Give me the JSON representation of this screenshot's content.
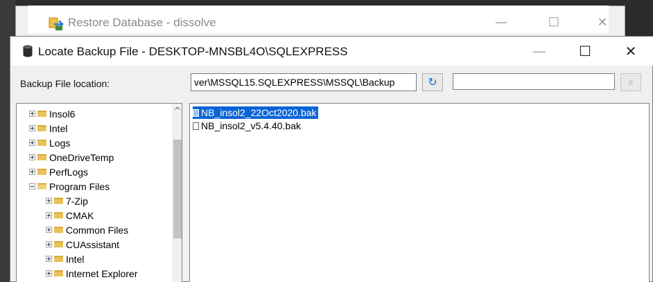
{
  "background_window": {
    "title": "Restore Database - dissolve",
    "controls": [
      "—",
      "☐",
      "✕"
    ]
  },
  "dialog": {
    "title": "Locate Backup File - DESKTOP-MNSBL4O\\SQLEXPRESS",
    "controls": [
      "—",
      "☐",
      "✕"
    ],
    "location_label": "Backup File location:",
    "location_value": "ver\\MSSQL15.SQLEXPRESS\\MSSQL\\Backup",
    "search_value": ""
  },
  "tree": {
    "items": [
      {
        "label": "Insol6",
        "expanded": false
      },
      {
        "label": "Intel",
        "expanded": false
      },
      {
        "label": "Logs",
        "expanded": false
      },
      {
        "label": "OneDriveTemp",
        "expanded": false
      },
      {
        "label": "PerfLogs",
        "expanded": false
      },
      {
        "label": "Program Files",
        "expanded": true
      },
      {
        "label": "7-Zip",
        "expanded": false
      },
      {
        "label": "CMAK",
        "expanded": false
      },
      {
        "label": "Common Files",
        "expanded": false
      },
      {
        "label": "CUAssistant",
        "expanded": false
      },
      {
        "label": "Intel",
        "expanded": false
      },
      {
        "label": "Internet Explorer",
        "expanded": false
      }
    ]
  },
  "files": {
    "items": [
      {
        "name": "NB_insol2_22Oct2020.bak",
        "selected": true
      },
      {
        "name": "NB_insol2_v5.4.40.bak",
        "selected": false
      }
    ]
  },
  "colors": {
    "selection": "#0a64d6",
    "folder": "#e8c25a",
    "refresh_accent": "#1a73c8"
  }
}
